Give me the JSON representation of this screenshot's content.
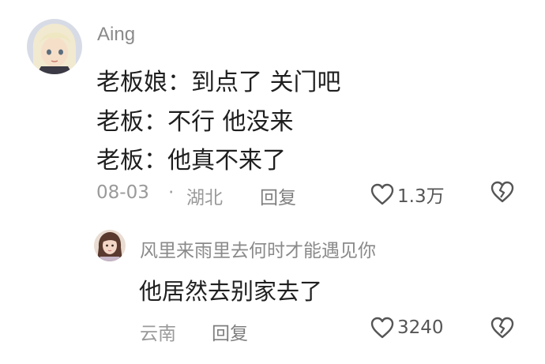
{
  "comment": {
    "username": "Aing",
    "lines": [
      "老板娘：到点了 关门吧",
      "老板：不行 他没来",
      "老板：他真不来了"
    ],
    "date": "08-03",
    "separator": "·",
    "location": "湖北",
    "reply_label": "回复",
    "like_count": "1.3万",
    "icons": {
      "avatar": "anime-avatar",
      "like": "heart-outline-icon",
      "dislike": "broken-heart-icon"
    }
  },
  "reply": {
    "username": "风里来雨里去何时才能遇见你",
    "text": "他居然去别家去了",
    "location": "云南",
    "reply_label": "回复",
    "like_count": "3240",
    "icons": {
      "avatar": "user-avatar",
      "like": "heart-outline-icon",
      "dislike": "broken-heart-icon"
    }
  },
  "colors": {
    "username": "#8a8a8a",
    "text": "#1f1f1f",
    "meta": "#9a9a9a",
    "icon": "#555555"
  }
}
